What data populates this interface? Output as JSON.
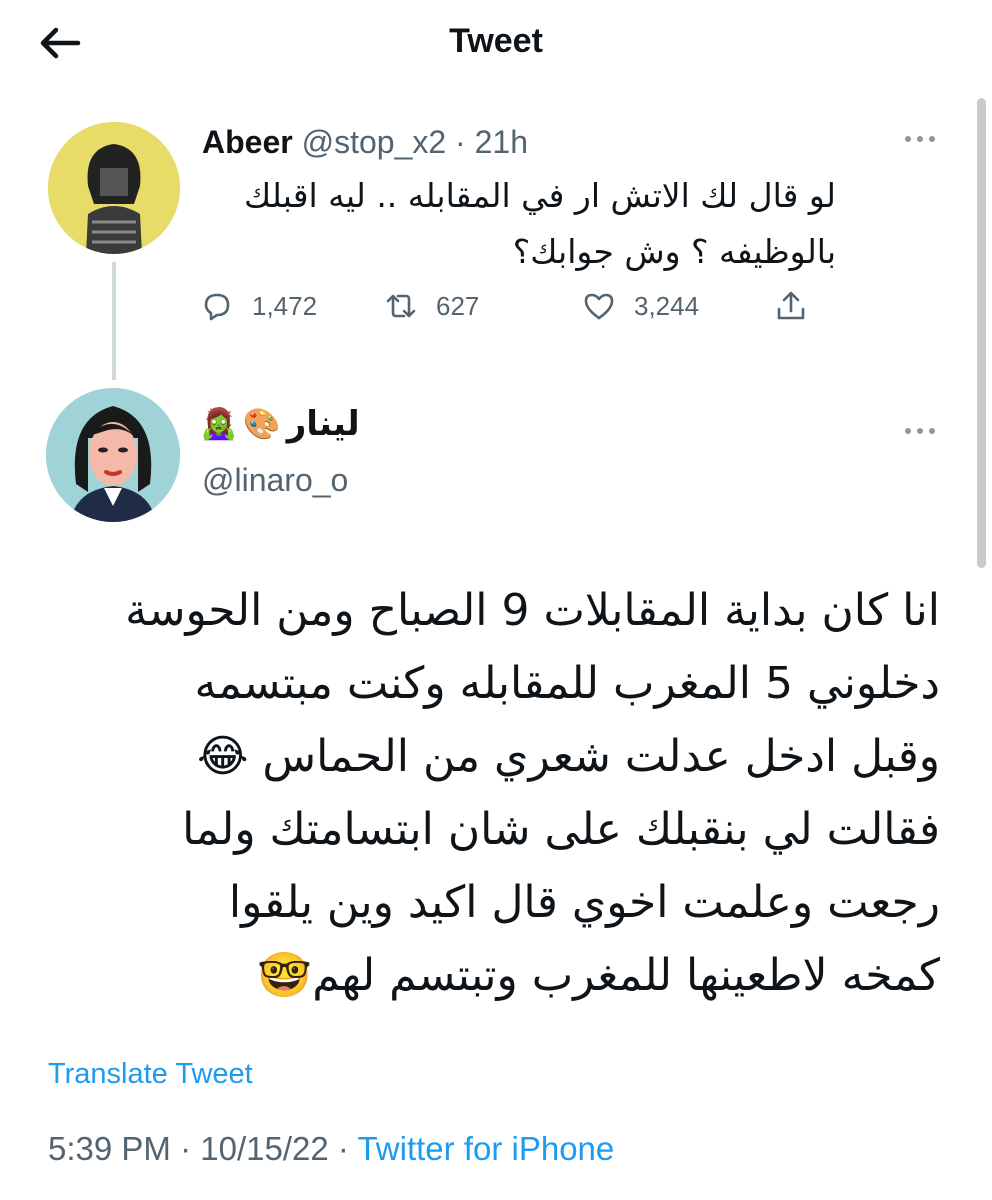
{
  "header": {
    "title": "Tweet",
    "back_icon": "arrow-left-icon"
  },
  "parent_tweet": {
    "name": "Abeer",
    "handle": "@stop_x2",
    "separator": "·",
    "time": "21h",
    "text_lines": [
      "لو قال لك الاتش ار في المقابله .. ليه اقبلك",
      "بالوظيفه ؟ وش جوابك؟"
    ],
    "replies": "1,472",
    "retweets": "627",
    "likes": "3,244"
  },
  "main_tweet": {
    "name": "لينار",
    "name_emojis": [
      "🧟‍♀️",
      "🎨"
    ],
    "handle": "@linaro_o",
    "text_lines": [
      "انا كان بداية المقابلات 9 الصباح ومن الحوسة",
      "دخلوني 5 المغرب للمقابله وكنت مبتسمه",
      "وقبل ادخل عدلت شعري من الحماس 😂",
      "فقالت لي بنقبلك على شان ابتسامتك ولما",
      "رجعت وعلمت اخوي قال اكيد وين يلقوا",
      "كمخه لاطعينها للمغرب وتبتسم لهم🤓"
    ],
    "translate_label": "Translate Tweet",
    "timestamp_time": "5:39 PM",
    "timestamp_date": "10/15/22",
    "separator": "·",
    "source": "Twitter for iPhone"
  },
  "colors": {
    "link": "#1d9bf0",
    "muted": "#536471",
    "text": "#0f1419",
    "thread_line": "#cfd9de"
  }
}
